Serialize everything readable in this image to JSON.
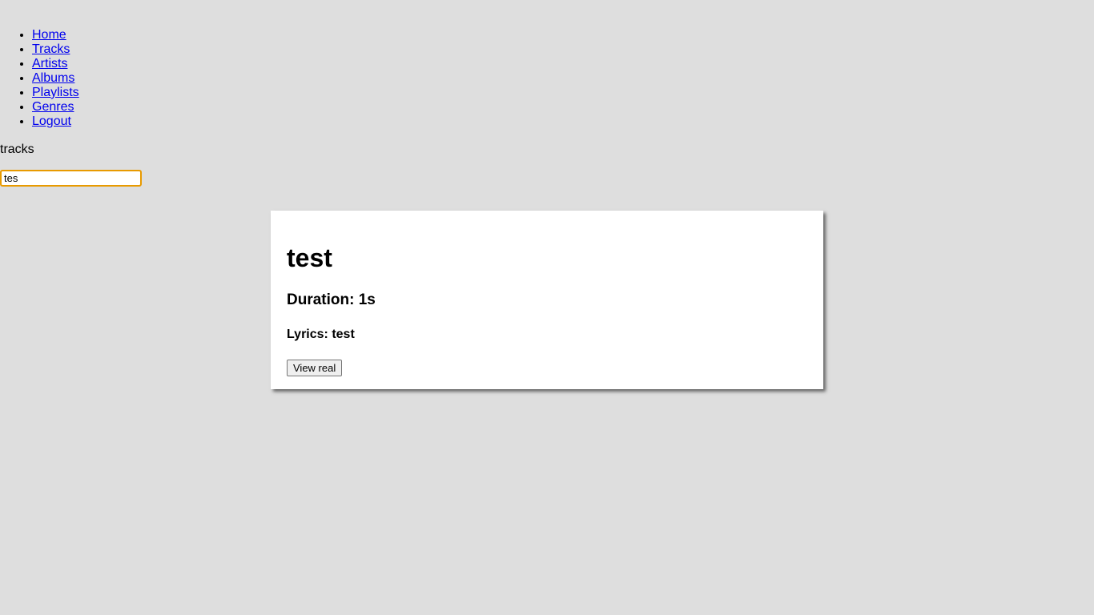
{
  "nav": [
    "Home",
    "Tracks",
    "Artists",
    "Albums",
    "Playlists",
    "Genres",
    "Logout"
  ],
  "page_label": "tracks",
  "search": {
    "value": "tes"
  },
  "track": {
    "title": "test",
    "duration": "Duration: 1s",
    "lyrics": "Lyrics: test",
    "button": "View real"
  }
}
